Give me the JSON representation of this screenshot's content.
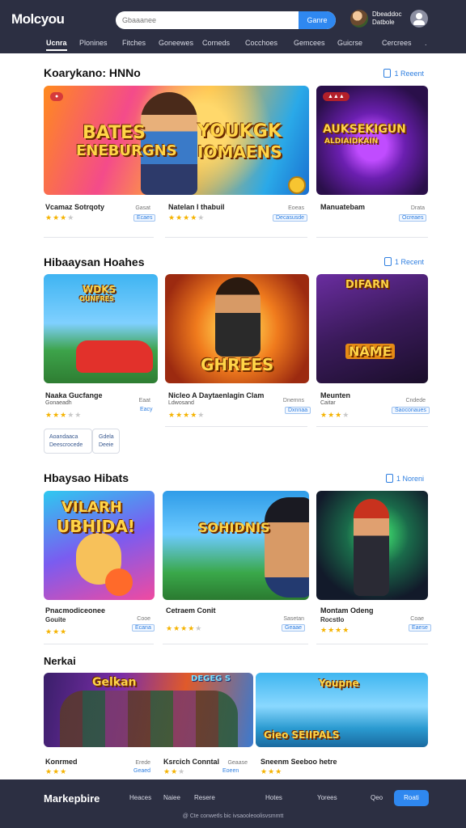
{
  "header": {
    "logo": "Molcyou",
    "search": {
      "placeholder": "Gbaaanee",
      "button": "Ganre"
    },
    "user": {
      "name_line1": "Dbeaddoc",
      "name_line2": "Datbole"
    },
    "nav": [
      "Ucnra",
      "Plonines",
      "Fitches",
      "Goneewes",
      "Corneds",
      "Cocchoes",
      "Gemcees",
      "Guicrse",
      "Cercrees",
      "."
    ]
  },
  "sections": [
    {
      "title": "Koarykano: HNNo",
      "link": "1 Reeent",
      "cards": [
        {
          "image_text": [
            "BATES",
            "ENEBURGNS"
          ],
          "image_text2": [
            "YOUKGK",
            "IOMAENS"
          ],
          "badge": "",
          "title": "Vcamaz Sotrqoty",
          "sub": "",
          "rating": 3,
          "price_small": "Gasat",
          "price": "Ecaes"
        },
        {
          "title": "Natelan I thabuil",
          "sub": "",
          "rating": 4,
          "price_small": "Eoeas",
          "price": "Decasusde"
        },
        {
          "image_text": [
            "AUKSEKIGUN",
            "ALDIAIDKAIN"
          ],
          "badge": "",
          "title": "Manuatebam",
          "sub": "",
          "rating": 0,
          "price_small": "Drata",
          "price": "Ocreaes"
        }
      ]
    },
    {
      "title": "Hibaaysan Hoahes",
      "link": "1 Recent",
      "cards": [
        {
          "image_text": [
            "WDKS",
            "OUNFRES"
          ],
          "title": "Naaka Gucfange",
          "sub": "Gonaeadh",
          "rating": 3.5,
          "price_small": "Eaat",
          "price": "Eacy"
        },
        {
          "image_text": [
            "GHREES"
          ],
          "title": "Nicleo A Daytaenlagin Clam",
          "sub": "Ldwosand",
          "rating": 4,
          "price_small": "Dnemns",
          "price": "Dxnnaa"
        },
        {
          "image_text": [
            "DIFARN",
            "NAME"
          ],
          "title": "Meunten",
          "sub": "Caitar",
          "rating": 3,
          "price_small": "Cndede",
          "price": "Saoconaues"
        }
      ],
      "mini": {
        "left": [
          "Aoandaaca",
          "Deescrocede"
        ],
        "right": [
          "Gdela",
          "Deeie"
        ]
      }
    },
    {
      "title": "Hbaysao Hibats",
      "link": "1 Noreni",
      "cards": [
        {
          "image_text": [
            "VILARH",
            "UBHIDA!"
          ],
          "title": "Pnacmodiceonee",
          "sub": "Gouite",
          "rating": 3,
          "price_small": "Cooe",
          "price": "Ecana"
        },
        {
          "image_text": [
            "SOHIDNIS"
          ],
          "title": "Cetraem Conit",
          "sub": "",
          "rating": 4,
          "price_small": "Sasetan",
          "price": "Geaae"
        },
        {
          "image_text": [],
          "title": "Montam Odeng",
          "sub": "Rocstlo",
          "rating": 4,
          "price_small": "Coae",
          "price": "Eaese"
        }
      ]
    },
    {
      "title": "Nerkai",
      "cards": [
        {
          "image_text": [
            "Gelkan"
          ],
          "image_text2": [
            "DEGEG S"
          ],
          "title": "Konrmed",
          "rating": 3,
          "price_small": "Erede",
          "price": "Geaed"
        },
        {
          "title": "Ksrcich Conntal",
          "rating": 2,
          "price_small": "Geaase",
          "price": "Eoeen"
        },
        {
          "image_text": [
            "Gieo SEIIPALS"
          ],
          "image_text2": [
            "Youpne"
          ],
          "title": "Sneenm Seeboo hetre",
          "rating": 3,
          "price_small": "",
          "price": ""
        }
      ]
    }
  ],
  "footer": {
    "logo": "Markepbire",
    "links": [
      "Heaces",
      "Naiee",
      "Resere",
      "Hotes",
      "Yorees",
      "Qeo"
    ],
    "button": "Roati",
    "copy": "@ Cte conwetls bic ivsaooleoolisvsmmtt"
  },
  "colors": {
    "header_bg": "#2c2f42",
    "accent": "#2f88f0",
    "star": "#f5b301"
  }
}
